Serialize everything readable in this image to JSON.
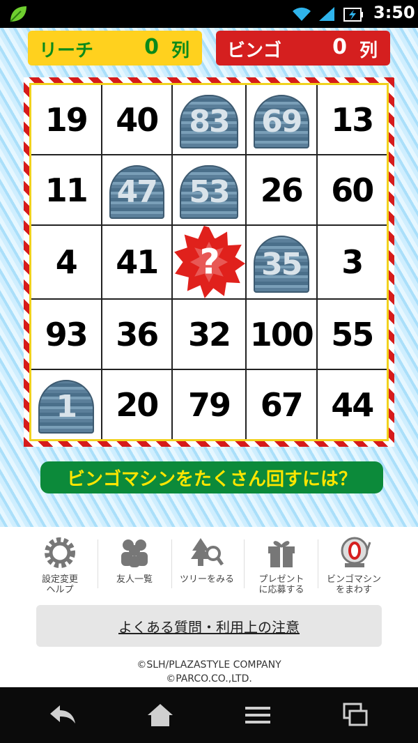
{
  "statusbar": {
    "time": "3:50"
  },
  "scores": {
    "reach_label": "リーチ",
    "reach_value": "0",
    "reach_unit": "列",
    "bingo_label": "ビンゴ",
    "bingo_value": "0",
    "bingo_unit": "列"
  },
  "board": {
    "cells": [
      {
        "n": "19",
        "marked": false
      },
      {
        "n": "40",
        "marked": false
      },
      {
        "n": "83",
        "marked": true
      },
      {
        "n": "69",
        "marked": true
      },
      {
        "n": "13",
        "marked": false
      },
      {
        "n": "11",
        "marked": false
      },
      {
        "n": "47",
        "marked": true
      },
      {
        "n": "53",
        "marked": true
      },
      {
        "n": "26",
        "marked": false
      },
      {
        "n": "60",
        "marked": false
      },
      {
        "n": "4",
        "marked": false
      },
      {
        "n": "41",
        "marked": false
      },
      {
        "n": "?",
        "free": true
      },
      {
        "n": "35",
        "marked": true
      },
      {
        "n": "3",
        "marked": false
      },
      {
        "n": "93",
        "marked": false
      },
      {
        "n": "36",
        "marked": false
      },
      {
        "n": "32",
        "marked": false
      },
      {
        "n": "100",
        "marked": false
      },
      {
        "n": "55",
        "marked": false
      },
      {
        "n": "1",
        "marked": true
      },
      {
        "n": "20",
        "marked": false
      },
      {
        "n": "79",
        "marked": false
      },
      {
        "n": "67",
        "marked": false
      },
      {
        "n": "44",
        "marked": false
      }
    ]
  },
  "help_button": "ビンゴマシンをたくさん回すには？",
  "menu": {
    "items": [
      {
        "label": "設定変更\nヘルプ",
        "icon": "gear-icon"
      },
      {
        "label": "友人一覧",
        "icon": "friends-icon"
      },
      {
        "label": "ツリーをみる",
        "icon": "tree-search-icon"
      },
      {
        "label": "プレゼント\nに応募する",
        "icon": "gift-icon"
      },
      {
        "label": "ビンゴマシン\nをまわす",
        "icon": "bingo-machine-icon"
      }
    ]
  },
  "faq_label": "よくある質問・利用上の注意",
  "copyright": {
    "line1": "©SLH/PLAZASTYLE COMPANY",
    "line2": "©PARCO.CO.,LTD."
  }
}
